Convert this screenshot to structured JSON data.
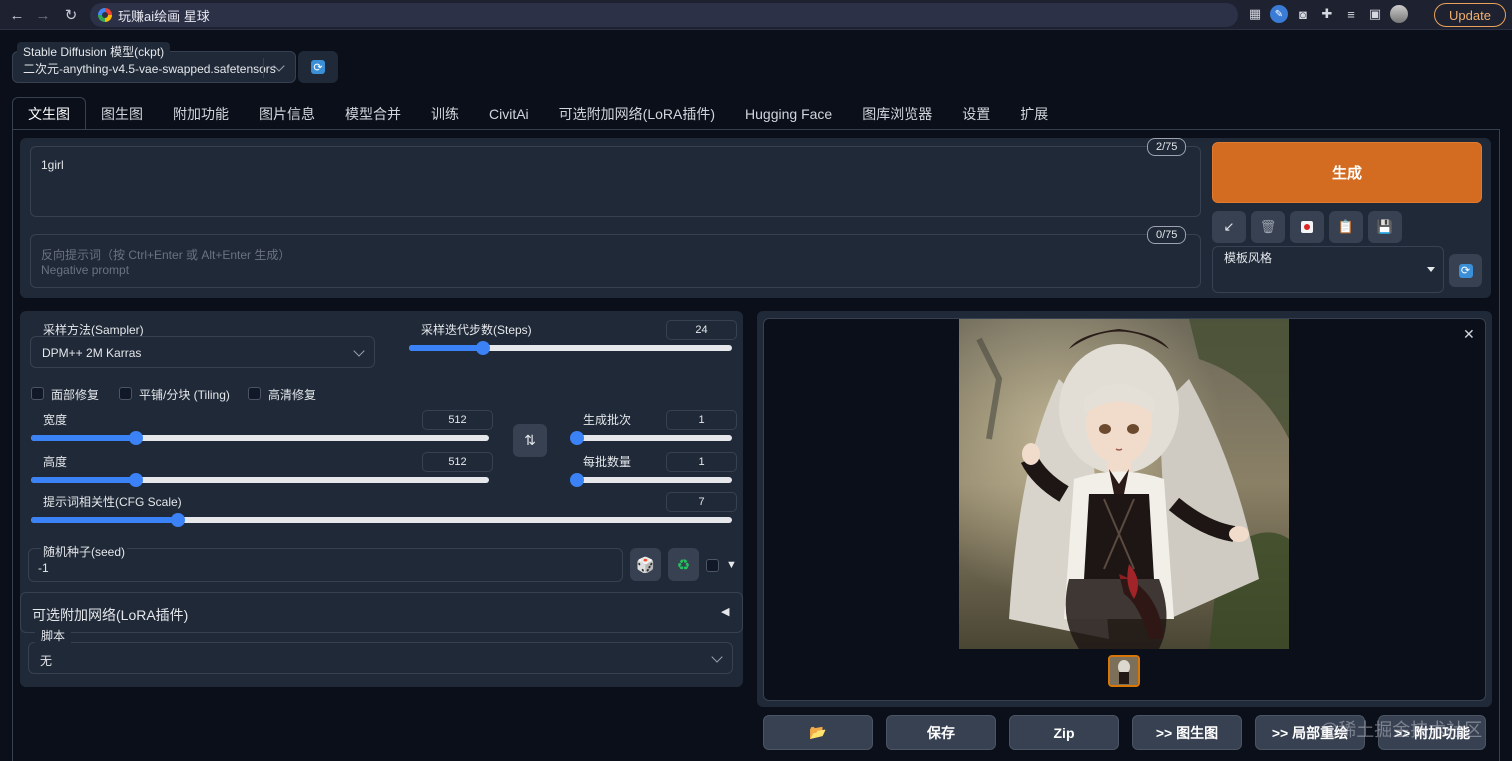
{
  "browser": {
    "page_title": "玩赚ai绘画 星球",
    "update_label": "Update"
  },
  "model": {
    "label": "Stable Diffusion 模型(ckpt)",
    "value": "二次元-anything-v4.5-vae-swapped.safetensors"
  },
  "tabs": [
    {
      "label": "文生图"
    },
    {
      "label": "图生图"
    },
    {
      "label": "附加功能"
    },
    {
      "label": "图片信息"
    },
    {
      "label": "模型合并"
    },
    {
      "label": "训练"
    },
    {
      "label": "CivitAi"
    },
    {
      "label": "可选附加网络(LoRA插件)"
    },
    {
      "label": "Hugging Face"
    },
    {
      "label": "图库浏览器"
    },
    {
      "label": "设置"
    },
    {
      "label": "扩展"
    }
  ],
  "prompt": {
    "value": "1girl",
    "counter": "2/75",
    "negative_placeholder_1": "反向提示词（按 Ctrl+Enter 或 Alt+Enter 生成）",
    "negative_placeholder_2": "Negative prompt",
    "negative_counter": "0/75"
  },
  "generate_label": "生成",
  "style": {
    "label": "模板风格"
  },
  "sampler": {
    "label": "采样方法(Sampler)",
    "value": "DPM++ 2M Karras"
  },
  "steps": {
    "label": "采样迭代步数(Steps)",
    "value": "24",
    "fraction": 0.23
  },
  "checkboxes": {
    "face_restore": "面部修复",
    "tiling": "平铺/分块 (Tiling)",
    "hires": "高清修复"
  },
  "width": {
    "label": "宽度",
    "value": "512",
    "fraction": 0.23
  },
  "height": {
    "label": "高度",
    "value": "512",
    "fraction": 0.23
  },
  "batch_count": {
    "label": "生成批次",
    "value": "1",
    "fraction": 0.0
  },
  "batch_size": {
    "label": "每批数量",
    "value": "1",
    "fraction": 0.0
  },
  "cfg": {
    "label": "提示词相关性(CFG Scale)",
    "value": "7",
    "fraction": 0.21
  },
  "seed": {
    "label": "随机种子(seed)",
    "value": "-1"
  },
  "lora_section": {
    "label": "可选附加网络(LoRA插件)"
  },
  "script": {
    "label": "脚本",
    "value": "无"
  },
  "actions": {
    "save": "保存",
    "zip": "Zip",
    "to_img2img": ">> 图生图",
    "to_inpaint": ">> 局部重绘",
    "to_extras": ">> 附加功能"
  },
  "watermark": "@稀土掘金技术社区",
  "colors": {
    "accent": "#d36b20",
    "slider": "#3b82f6",
    "background": "#0b0f19",
    "panel": "#1f2937"
  }
}
